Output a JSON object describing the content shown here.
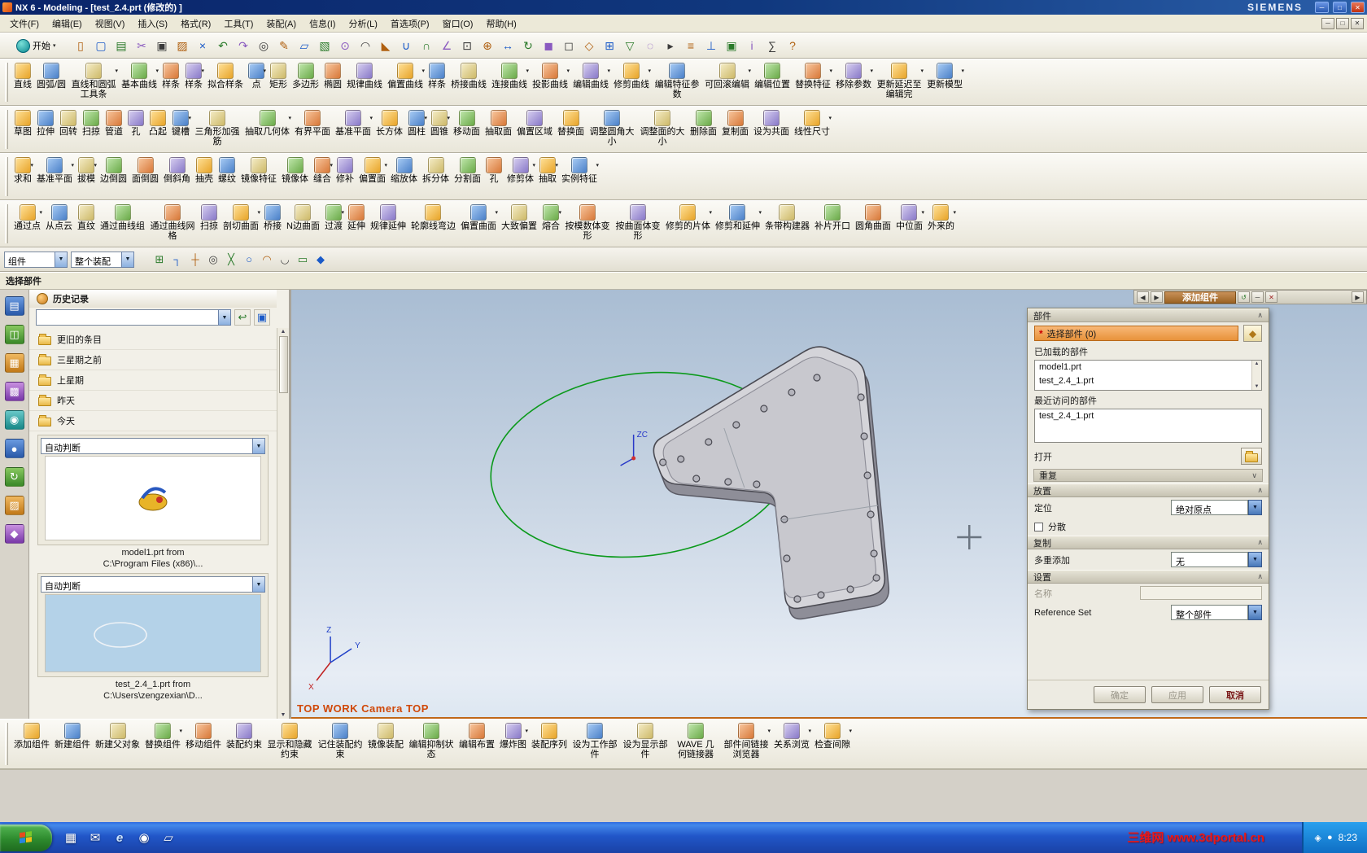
{
  "glyphs": {
    "dropdown": "▾",
    "up": "▲",
    "down": "▼",
    "left": "◀",
    "right": "▶",
    "chev_up": "∧",
    "chev_down": "∨",
    "check": "",
    "asterisk": "*"
  },
  "titlebar": {
    "title": "NX 6 - Modeling - [test_2.4.prt (修改的) ]",
    "brand": "SIEMENS",
    "buttons": {
      "minimize": "─",
      "maximize": "□",
      "close": "✕"
    }
  },
  "menubar": {
    "items": [
      "文件(F)",
      "编辑(E)",
      "视图(V)",
      "插入(S)",
      "格式(R)",
      "工具(T)",
      "装配(A)",
      "信息(I)",
      "分析(L)",
      "首选项(P)",
      "窗口(O)",
      "帮助(H)"
    ],
    "window_buttons": {
      "minimize": "─",
      "restore": "□",
      "close": "✕"
    }
  },
  "standard_toolbar": {
    "start_label": "开始",
    "start_arrow": "▾",
    "icons": [
      {
        "name": "new-part-icon",
        "glyph": "▯"
      },
      {
        "name": "open-icon",
        "glyph": "▢"
      },
      {
        "name": "save-icon",
        "glyph": "▤"
      },
      {
        "name": "cut-icon",
        "glyph": "✂"
      },
      {
        "name": "copy-icon",
        "glyph": "▣"
      },
      {
        "name": "paste-icon",
        "glyph": "▨"
      },
      {
        "name": "delete-icon",
        "glyph": "×"
      },
      {
        "name": "undo-icon",
        "glyph": "↶"
      },
      {
        "name": "redo-icon",
        "glyph": "↷"
      },
      {
        "name": "command-finder-icon",
        "glyph": "◎"
      },
      {
        "name": "sketch-icon",
        "glyph": "✎"
      },
      {
        "name": "datum-plane-icon",
        "glyph": "▱"
      },
      {
        "name": "extrude-icon",
        "glyph": "▧"
      },
      {
        "name": "hole-icon",
        "glyph": "⊙"
      },
      {
        "name": "edge-blend-icon",
        "glyph": "◠"
      },
      {
        "name": "chamfer-icon",
        "glyph": "◣"
      },
      {
        "name": "unite-icon",
        "glyph": "∪"
      },
      {
        "name": "intersect-icon",
        "glyph": "∩"
      },
      {
        "name": "measure-icon",
        "glyph": "∠"
      },
      {
        "name": "fit-view-icon",
        "glyph": "⊡"
      },
      {
        "name": "zoom-icon",
        "glyph": "⊕"
      },
      {
        "name": "pan-icon",
        "glyph": "↔"
      },
      {
        "name": "rotate-view-icon",
        "glyph": "↻"
      },
      {
        "name": "shaded-view-icon",
        "glyph": "◼"
      },
      {
        "name": "wireframe-view-icon",
        "glyph": "◻"
      },
      {
        "name": "orient-view-icon",
        "glyph": "◇"
      },
      {
        "name": "snap-point-icon",
        "glyph": "⊞"
      },
      {
        "name": "selection-filter-icon",
        "glyph": "▽"
      },
      {
        "name": "show-hide-icon",
        "glyph": "◌"
      },
      {
        "name": "move-object-icon",
        "glyph": "▸"
      },
      {
        "name": "layer-settings-icon",
        "glyph": "≡"
      },
      {
        "name": "constraints-icon",
        "glyph": "⊥"
      },
      {
        "name": "window-icon",
        "glyph": "▣"
      },
      {
        "name": "information-icon",
        "glyph": "i"
      },
      {
        "name": "analysis-icon",
        "glyph": "∑"
      },
      {
        "name": "help-icon",
        "glyph": "?"
      }
    ]
  },
  "toolbars": {
    "curves": {
      "items": [
        {
          "label": "直线"
        },
        {
          "label": "圆弧/圆"
        },
        {
          "label": "直线和圆弧工具条",
          "arrow": "▾"
        },
        {
          "label": "基本曲线",
          "arrow": "▾"
        },
        {
          "label": "样条"
        },
        {
          "label": "样条",
          "arrow": "▾"
        },
        {
          "label": "拟合样条"
        },
        {
          "label": "点",
          "arrow": "▾"
        },
        {
          "label": "矩形"
        },
        {
          "label": "多边形"
        },
        {
          "label": "椭圆"
        },
        {
          "label": "规律曲线"
        },
        {
          "label": "偏置曲线",
          "arrow": "▾"
        },
        {
          "label": "样条"
        },
        {
          "label": "桥接曲线"
        },
        {
          "label": "连接曲线",
          "arrow": "▾"
        },
        {
          "label": "投影曲线",
          "arrow": "▾"
        },
        {
          "label": "编辑曲线",
          "arrow": "▾"
        },
        {
          "label": "修剪曲线",
          "arrow": "▾"
        },
        {
          "label": "编辑特征参数"
        },
        {
          "label": "可回滚编辑",
          "arrow": "▾"
        },
        {
          "label": "编辑位置"
        },
        {
          "label": "替换特征",
          "arrow": "▾"
        },
        {
          "label": "移除参数",
          "arrow": "▾"
        },
        {
          "label": "更新延迟至编辑完",
          "arrow": "▾"
        },
        {
          "label": "更新模型",
          "arrow": "▾"
        }
      ]
    },
    "features": {
      "items": [
        {
          "label": "草图"
        },
        {
          "label": "拉伸"
        },
        {
          "label": "回转"
        },
        {
          "label": "扫掠"
        },
        {
          "label": "管道"
        },
        {
          "label": "孔"
        },
        {
          "label": "凸起"
        },
        {
          "label": "键槽",
          "arrow": "▾"
        },
        {
          "label": "三角形加强筋"
        },
        {
          "label": "抽取几何体",
          "arrow": "▾"
        },
        {
          "label": "有界平面"
        },
        {
          "label": "基准平面",
          "arrow": "▾"
        },
        {
          "label": "长方体"
        },
        {
          "label": "圆柱",
          "arrow": "▾"
        },
        {
          "label": "圆锥",
          "arrow": "▾"
        },
        {
          "label": "移动面"
        },
        {
          "label": "抽取面"
        },
        {
          "label": "偏置区域"
        },
        {
          "label": "替换面"
        },
        {
          "label": "调整圆角大小"
        },
        {
          "label": "调整面的大小"
        },
        {
          "label": "删除面"
        },
        {
          "label": "复制面"
        },
        {
          "label": "设为共面"
        },
        {
          "label": "线性尺寸",
          "arrow": "▾"
        }
      ]
    },
    "operations": {
      "items": [
        {
          "label": "求和",
          "arrow": "▾"
        },
        {
          "label": "基准平面",
          "arrow": "▾"
        },
        {
          "label": "拔模",
          "arrow": "▾"
        },
        {
          "label": "边倒圆"
        },
        {
          "label": "面倒圆"
        },
        {
          "label": "倒斜角"
        },
        {
          "label": "抽壳"
        },
        {
          "label": "螺纹"
        },
        {
          "label": "镜像特征"
        },
        {
          "label": "镜像体"
        },
        {
          "label": "缝合",
          "arrow": "▾"
        },
        {
          "label": "修补"
        },
        {
          "label": "偏置面",
          "arrow": "▾"
        },
        {
          "label": "缩放体"
        },
        {
          "label": "拆分体"
        },
        {
          "label": "分割面"
        },
        {
          "label": "孔"
        },
        {
          "label": "修剪体",
          "arrow": "▾"
        },
        {
          "label": "抽取",
          "arrow": "▾"
        },
        {
          "label": "实例特征",
          "arrow": "▾"
        }
      ]
    },
    "surfaces": {
      "items": [
        {
          "label": "通过点",
          "arrow": "▾"
        },
        {
          "label": "从点云"
        },
        {
          "label": "直纹"
        },
        {
          "label": "通过曲线组"
        },
        {
          "label": "通过曲线网格"
        },
        {
          "label": "扫掠"
        },
        {
          "label": "剖切曲面",
          "arrow": "▾"
        },
        {
          "label": "桥接"
        },
        {
          "label": "N边曲面"
        },
        {
          "label": "过渡",
          "arrow": "▾"
        },
        {
          "label": "延伸"
        },
        {
          "label": "规律延伸"
        },
        {
          "label": "轮廓线弯边"
        },
        {
          "label": "偏置曲面",
          "arrow": "▾"
        },
        {
          "label": "大致偏置"
        },
        {
          "label": "熔合",
          "arrow": "▾"
        },
        {
          "label": "按模数体变形"
        },
        {
          "label": "按曲面体变形"
        },
        {
          "label": "修剪的片体",
          "arrow": "▾"
        },
        {
          "label": "修剪和延伸",
          "arrow": "▾"
        },
        {
          "label": "条带构建器"
        },
        {
          "label": "补片开口"
        },
        {
          "label": "圆角曲面"
        },
        {
          "label": "中位面",
          "arrow": "▾"
        },
        {
          "label": "外来的",
          "arrow": "▾"
        }
      ]
    }
  },
  "selection_bar": {
    "filter_value": "组件",
    "scope_value": "整个装配",
    "icons": [
      {
        "name": "snap-point-toggle-icon",
        "glyph": "⊞"
      },
      {
        "name": "endpoint-snap-icon",
        "glyph": "┐"
      },
      {
        "name": "midpoint-snap-icon",
        "glyph": "┼"
      },
      {
        "name": "center-snap-icon",
        "glyph": "◎"
      },
      {
        "name": "intersection-snap-icon",
        "glyph": "╳"
      },
      {
        "name": "quadrant-snap-icon",
        "glyph": "○"
      },
      {
        "name": "point-on-curve-snap-icon",
        "glyph": "◠"
      },
      {
        "name": "tangent-snap-icon",
        "glyph": "◡"
      },
      {
        "name": "rectangle-select-icon",
        "glyph": "▭"
      },
      {
        "name": "shaded-cube-icon",
        "glyph": "◆"
      }
    ]
  },
  "cue_bar": {
    "text": "选择部件"
  },
  "resource_bar": {
    "icons": [
      {
        "name": "assembly-navigator-icon",
        "glyph": "▤"
      },
      {
        "name": "constraint-navigator-icon",
        "glyph": "◫"
      },
      {
        "name": "part-navigator-icon",
        "glyph": "▦"
      },
      {
        "name": "reuse-library-icon",
        "glyph": "▩"
      },
      {
        "name": "hd3d-tools-icon",
        "glyph": "◉"
      },
      {
        "name": "web-browser-icon",
        "glyph": "●"
      },
      {
        "name": "history-icon",
        "glyph": "↻"
      },
      {
        "name": "materials-icon",
        "glyph": "▨"
      },
      {
        "name": "roles-icon",
        "glyph": "◆"
      }
    ]
  },
  "history": {
    "title": "历史记录",
    "folders": [
      "更旧的条目",
      "三星期之前",
      "上星期",
      "昨天",
      "今天"
    ],
    "entry1": {
      "filter": "自动判断",
      "caption1": "model1.prt from",
      "caption2": "C:\\Program Files (x86)\\..."
    },
    "entry2": {
      "filter": "自动判断",
      "caption1": "test_2.4_1.prt from",
      "caption2": "C:\\Users\\zengzexian\\D..."
    }
  },
  "viewport": {
    "view_label": "TOP WORK Camera TOP",
    "csys_label": "ZC",
    "axis_x": "X",
    "axis_y": "Y",
    "axis_z": "Z"
  },
  "dialog_rail": {
    "back": "◀",
    "forward": "▶",
    "title": "添加组件",
    "undo": "↺",
    "minimize": "─",
    "close": "✕",
    "more": "▶"
  },
  "dialog": {
    "section_part": "部件",
    "select_part_label": "选择部件 (0)",
    "loaded_label": "已加载的部件",
    "loaded_parts": [
      "model1.prt",
      "test_2.4_1.prt"
    ],
    "recent_label": "最近访问的部件",
    "recent_parts": [
      "test_2.4_1.prt"
    ],
    "open_label": "打开",
    "duplicate_label": "重复",
    "section_placement": "放置",
    "positioning_label": "定位",
    "positioning_value": "绝对原点",
    "scatter_label": "分散",
    "section_copy": "复制",
    "multiple_add_label": "多重添加",
    "multiple_add_value": "无",
    "section_settings": "设置",
    "name_label": "名称",
    "reference_set_label": "Reference Set",
    "reference_set_value": "整个部件",
    "ok_label": "确定",
    "apply_label": "应用",
    "cancel_label": "取消"
  },
  "assembly_toolbar": {
    "items": [
      {
        "label": "添加组件"
      },
      {
        "label": "新建组件"
      },
      {
        "label": "新建父对象"
      },
      {
        "label": "替换组件",
        "arrow": "▾"
      },
      {
        "label": "移动组件"
      },
      {
        "label": "装配约束"
      },
      {
        "label": "显示和隐藏约束"
      },
      {
        "label": "记住装配约束"
      },
      {
        "label": "镜像装配"
      },
      {
        "label": "编辑抑制状态"
      },
      {
        "label": "编辑布置"
      },
      {
        "label": "爆炸图",
        "arrow": "▾"
      },
      {
        "label": "装配序列"
      },
      {
        "label": "设为工作部件"
      },
      {
        "label": "设为显示部件"
      },
      {
        "label": "WAVE 几何链接器"
      },
      {
        "label": "部件间链接浏览器",
        "arrow": "▾"
      },
      {
        "label": "关系浏览",
        "arrow": "▾"
      },
      {
        "label": "检查间隙",
        "arrow": "▾"
      }
    ]
  },
  "taskbar": {
    "time": "8:23",
    "watermark": "三维网 www.3dportal.cn",
    "quick_launch": [
      {
        "name": "show-desktop-icon",
        "glyph": "▦"
      },
      {
        "name": "mail-icon",
        "glyph": "✉"
      },
      {
        "name": "ie-icon",
        "glyph": "e"
      },
      {
        "name": "nx-launcher-icon",
        "glyph": "◉"
      },
      {
        "name": "file-manager-icon",
        "glyph": "▱"
      }
    ],
    "tray_icons": [
      {
        "name": "safety-tray-icon",
        "glyph": "◈"
      },
      {
        "name": "ime-tray-icon",
        "glyph": "●"
      }
    ]
  }
}
